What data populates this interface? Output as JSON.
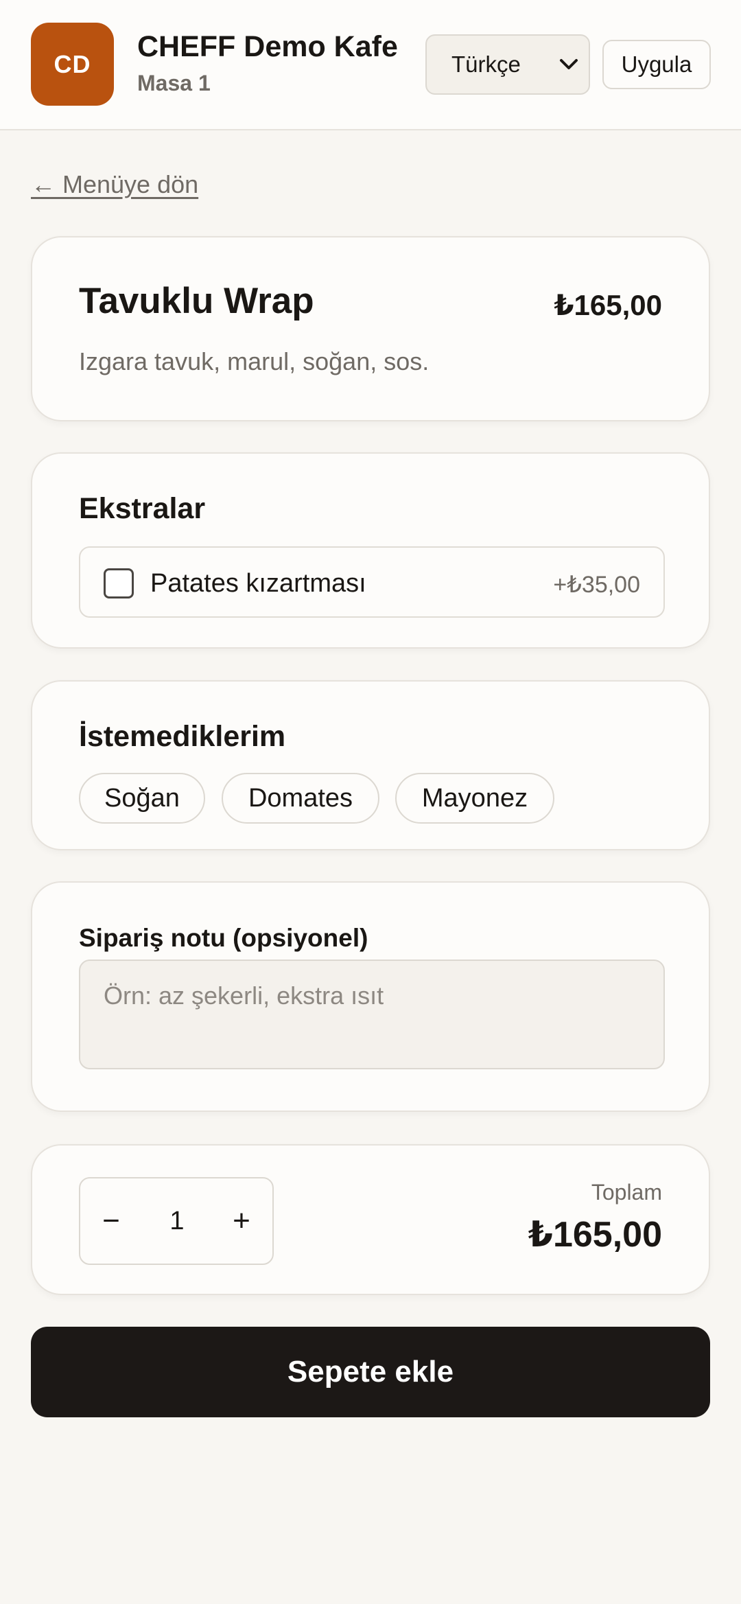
{
  "header": {
    "logo_initials": "CD",
    "cafe_name": "CHEFF Demo Kafe",
    "table_name": "Masa 1",
    "language_selected": "Türkçe",
    "apply_label": "Uygula"
  },
  "nav": {
    "back_label": "← Menüye dön"
  },
  "item": {
    "title": "Tavuklu Wrap",
    "price": "₺165,00",
    "description": "Izgara tavuk, marul, soğan, sos."
  },
  "extras": {
    "title": "Ekstralar",
    "options": [
      {
        "label": "Patates kızartması",
        "price": "+₺35,00",
        "checked": false
      }
    ]
  },
  "exclusions": {
    "title": "İstemediklerim",
    "chips": [
      "Soğan",
      "Domates",
      "Mayonez"
    ]
  },
  "note": {
    "label": "Sipariş notu (opsiyonel)",
    "placeholder": "Örn: az şekerli, ekstra ısıt",
    "value": ""
  },
  "quantity": {
    "minus_label": "−",
    "value": "1",
    "plus_label": "+"
  },
  "total": {
    "label": "Toplam",
    "value": "₺165,00"
  },
  "cta": {
    "add_to_cart_label": "Sepete ekle"
  },
  "colors": {
    "brand": "#b9520f",
    "background": "#f8f6f2",
    "card": "#fdfcfa",
    "primary_button": "#1c1816",
    "muted_text": "#6f6a64"
  }
}
